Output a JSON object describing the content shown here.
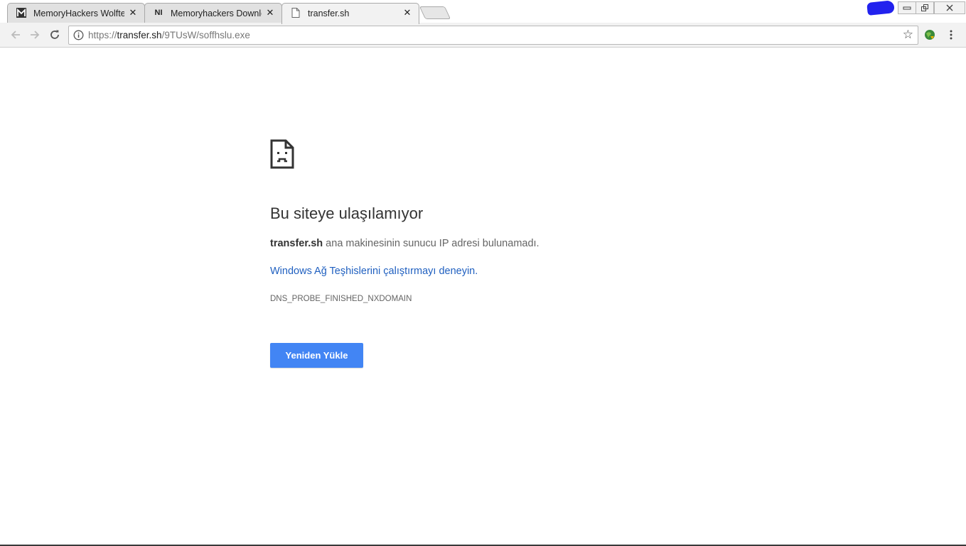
{
  "tabs": [
    {
      "title": "MemoryHackers Wolftea",
      "favicon": "M",
      "close": "✕",
      "active": false
    },
    {
      "title": "Memoryhackers Downloa",
      "favicon": "NI",
      "close": "✕",
      "active": false
    },
    {
      "title": "transfer.sh",
      "favicon": "page-icon",
      "close": "✕",
      "active": true
    }
  ],
  "omnibox": {
    "url_prefix": "https://",
    "url_host": "transfer.sh",
    "url_path": "/9TUsW/soffhslu.exe"
  },
  "error": {
    "heading": "Bu siteye ulaşılamıyor",
    "host": "transfer.sh",
    "description": " ana makinesinin sunucu IP adresi bulunamadı.",
    "link": "Windows Ağ Teşhislerini çalıştırmayı deneyin.",
    "code": "DNS_PROBE_FINISHED_NXDOMAIN",
    "button": "Yeniden Yükle"
  },
  "colors": {
    "accent_button": "#4285f4",
    "link": "#2060c0",
    "annotation_scribble": "#2222ee"
  }
}
